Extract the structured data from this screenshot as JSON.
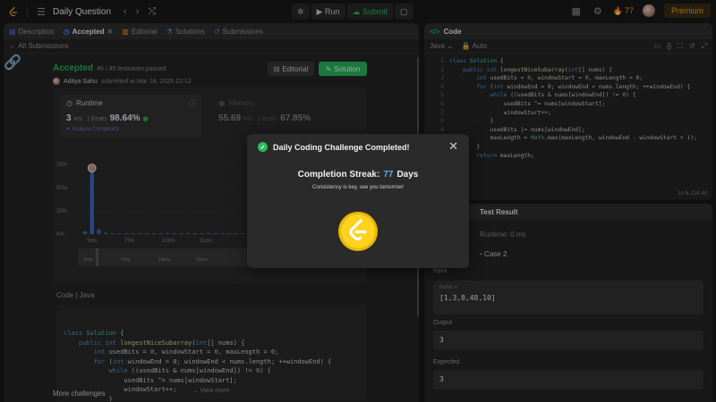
{
  "topbar": {
    "title": "Daily Question",
    "run_label": "Run",
    "submit_label": "Submit",
    "streak_count": "77",
    "premium_label": "Premium"
  },
  "tabs": [
    {
      "label": "Description"
    },
    {
      "label": "Accepted"
    },
    {
      "label": "Editorial"
    },
    {
      "label": "Solutions"
    },
    {
      "label": "Submissions"
    }
  ],
  "back_label": "All Submissions",
  "submission": {
    "status": "Accepted",
    "passed": "45 / 45 testcases passed",
    "author": "Aditya Sahu",
    "submitted": "submitted at Mar 18, 2025 22:12",
    "editorial_button": "Editorial",
    "solution_button": "Solution"
  },
  "runtime": {
    "title": "Runtime",
    "value": "3",
    "unit": "ms",
    "beats_label": "| Beats",
    "beats": "98.64%",
    "analyze": "Analyze Complexity"
  },
  "memory": {
    "title": "Memory",
    "value": "55.69",
    "unit": "MB",
    "beats_label": "| Beats",
    "beats": "67.85%"
  },
  "chart_data": {
    "type": "bar",
    "y_ticks": [
      "75%",
      "50%",
      "25%",
      "0%"
    ],
    "x_ticks": [
      "3ms",
      "7ms",
      "10ms",
      "11ms"
    ],
    "mini_ticks": [
      "2ms",
      "7ms",
      "10ms",
      "11ms"
    ],
    "ylim": [
      0,
      75
    ],
    "values": [
      3,
      70,
      5,
      1.5,
      1,
      1,
      0.8,
      0.8,
      0.6,
      0.6,
      0.5,
      0.5,
      0.5,
      0.4,
      0.4,
      0.4,
      0.3,
      0.3,
      0.3,
      0.3,
      0.3,
      0.3,
      0.3,
      0.3
    ],
    "highlight_index": 1
  },
  "code_section": {
    "label": "Code",
    "language": "Java",
    "lines": [
      "class Solution {",
      "    public int longestNiceSubarray(int[] nums) {",
      "        int usedBits = 0, windowStart = 0, maxLength = 0;",
      "        for (int windowEnd = 0; windowEnd < nums.length; ++windowEnd) {",
      "            while ((usedBits & nums[windowEnd]) != 0) {",
      "                usedBits ^= nums[windowStart];",
      "                windowStart++;",
      "            }"
    ],
    "view_more": "View more"
  },
  "more_challenges": "More challenges",
  "editor": {
    "title": "Code",
    "language": "Java",
    "auto": "Auto",
    "line_numbers": [
      "1",
      "2",
      "3",
      "4",
      "5",
      "6",
      "7",
      "8",
      "9",
      "10",
      "11",
      "12",
      "13",
      "14"
    ],
    "lines": [
      "class Solution {",
      "    public int longestNiceSubarray(int[] nums) {",
      "        int usedBits = 0, windowStart = 0, maxLength = 0;",
      "        for (int windowEnd = 0; windowEnd < nums.length; ++windowEnd) {",
      "            while ((usedBits & nums[windowEnd]) != 0) {",
      "                usedBits ^= nums[windowStart];",
      "                windowStart++;",
      "            }",
      "            usedBits |= nums[windowEnd];",
      "            maxLength = Math.max(maxLength, windowEnd - windowStart + 1);",
      "        }",
      "        return maxLength;",
      "    }",
      "}"
    ],
    "cursor": "Ln 6, Col 40"
  },
  "test": {
    "title": "Test Result",
    "runtime": "Runtime: 0 ms",
    "case": "Case 2",
    "input_label": "Input",
    "var_name": "nums =",
    "input_value": "[1,3,8,48,10]",
    "output_label": "Output",
    "output_value": "3",
    "expected_label": "Expected",
    "expected_value": "3"
  },
  "modal": {
    "title": "Daily Coding Challenge Completed!",
    "streak_prefix": "Completion Streak:",
    "streak_value": "77",
    "streak_suffix": "Days",
    "message": "Consistency is key, see you tomorrow!"
  },
  "colors": {
    "accent_green": "#2cbb5d",
    "accent_orange": "#ffa116",
    "streak_blue": "#6aa5ff",
    "bar_blue": "#3b6fd8"
  }
}
